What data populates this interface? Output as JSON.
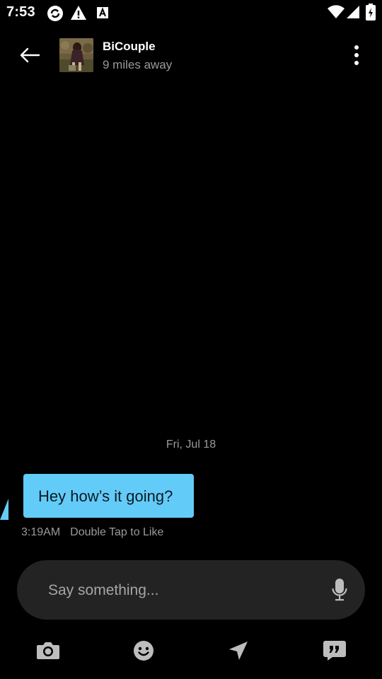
{
  "status_bar": {
    "time": "7:53",
    "icons": [
      "sync-icon",
      "warning-icon",
      "font-a-icon",
      "wifi-icon",
      "cellular-signal-icon",
      "battery-charging-icon"
    ]
  },
  "header": {
    "back_icon": "arrow-left-icon",
    "contact_name": "BiCouple",
    "distance": "9 miles away",
    "more_icon": "more-vertical-icon"
  },
  "conversation": {
    "date_separator": "Fri, Jul 18",
    "messages": [
      {
        "text": "Hey how’s it going?",
        "time": "3:19AM",
        "like_hint": "Double Tap to Like",
        "bubble_color": "#63cbf8"
      }
    ]
  },
  "composer": {
    "placeholder": "Say something...",
    "value": "",
    "mic_icon": "microphone-icon"
  },
  "toolbar": {
    "items": [
      {
        "icon": "camera-icon"
      },
      {
        "icon": "emoji-icon"
      },
      {
        "icon": "location-arrow-icon"
      },
      {
        "icon": "quote-chat-icon"
      }
    ]
  },
  "colors": {
    "background": "#000000",
    "bubble": "#63cbf8",
    "muted_text": "#9a9a9a",
    "composer_bg": "#232323",
    "icon_gray": "#bdbdbd"
  }
}
